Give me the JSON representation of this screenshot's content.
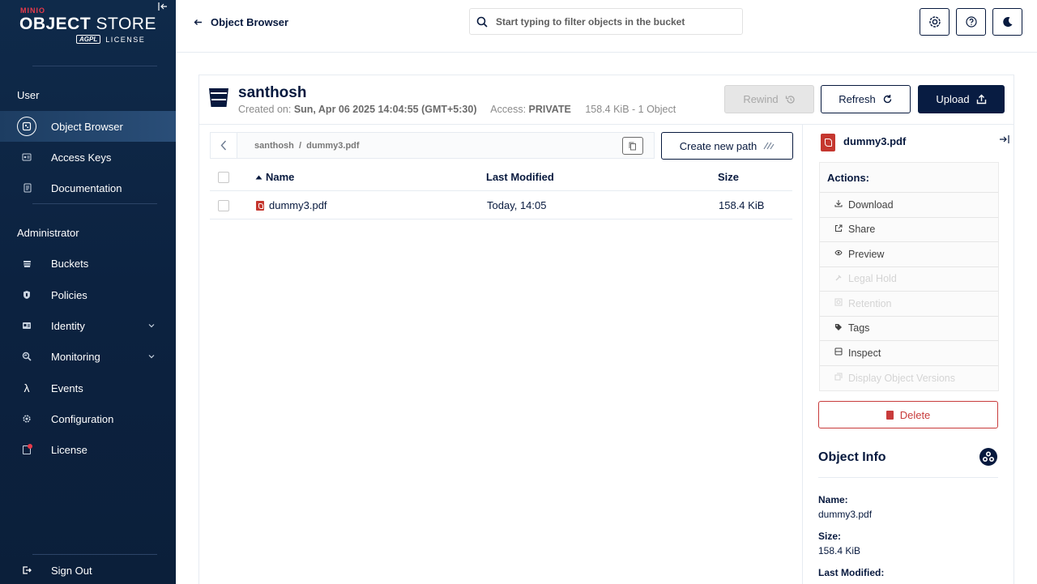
{
  "brand": {
    "minio": "MINIO",
    "title_bold": "OBJECT",
    "title_rest": " STORE",
    "agpl": "AGPL",
    "license": "LICENSE"
  },
  "sidebar": {
    "section_user": "User",
    "section_admin": "Administrator",
    "user_items": [
      {
        "label": "Object Browser",
        "icon": "object-browser-icon",
        "active": true
      },
      {
        "label": "Access Keys",
        "icon": "access-keys-icon"
      },
      {
        "label": "Documentation",
        "icon": "documentation-icon"
      }
    ],
    "admin_items": [
      {
        "label": "Buckets",
        "icon": "buckets-icon"
      },
      {
        "label": "Policies",
        "icon": "policies-icon"
      },
      {
        "label": "Identity",
        "icon": "identity-icon",
        "expandable": true
      },
      {
        "label": "Monitoring",
        "icon": "monitoring-icon",
        "expandable": true
      },
      {
        "label": "Events",
        "icon": "lambda-icon"
      },
      {
        "label": "Configuration",
        "icon": "gear-icon"
      },
      {
        "label": "License",
        "icon": "license-icon"
      }
    ],
    "sign_out": "Sign Out"
  },
  "topbar": {
    "back_label": "Object Browser",
    "search_placeholder": "Start typing to filter objects in the bucket"
  },
  "bucket": {
    "name": "santhosh",
    "created_label": "Created on:",
    "created_value": "Sun, Apr 06 2025 14:04:55 (GMT+5:30)",
    "access_label": "Access:",
    "access_value": "PRIVATE",
    "usage": "158.4 KiB - 1 Object",
    "rewind_label": "Rewind",
    "refresh_label": "Refresh",
    "upload_label": "Upload"
  },
  "browser": {
    "breadcrumb": "santhosh  /  dummy3.pdf",
    "create_path_label": "Create new path",
    "columns": {
      "name": "Name",
      "modified": "Last Modified",
      "size": "Size"
    },
    "rows": [
      {
        "name": "dummy3.pdf",
        "modified": "Today, 14:05",
        "size": "158.4 KiB"
      }
    ]
  },
  "details": {
    "filename": "dummy3.pdf",
    "actions_title": "Actions:",
    "actions": [
      {
        "label": "Download",
        "icon": "download-icon",
        "enabled": true
      },
      {
        "label": "Share",
        "icon": "share-icon",
        "enabled": true
      },
      {
        "label": "Preview",
        "icon": "eye-icon",
        "enabled": true
      },
      {
        "label": "Legal Hold",
        "icon": "legal-hold-icon",
        "enabled": false
      },
      {
        "label": "Retention",
        "icon": "retention-icon",
        "enabled": false
      },
      {
        "label": "Tags",
        "icon": "tag-icon",
        "enabled": true
      },
      {
        "label": "Inspect",
        "icon": "inspect-icon",
        "enabled": true
      },
      {
        "label": "Display Object Versions",
        "icon": "versions-icon",
        "enabled": false
      }
    ],
    "delete_label": "Delete",
    "info_title": "Object Info",
    "name_label": "Name:",
    "name_value": "dummy3.pdf",
    "size_label": "Size:",
    "size_value": "158.4 KiB",
    "modified_label": "Last Modified:"
  },
  "colors": {
    "sidebar_bg": "#0c2240",
    "primary": "#081c42",
    "danger": "#c83b3b",
    "pdf": "#c5372f"
  }
}
